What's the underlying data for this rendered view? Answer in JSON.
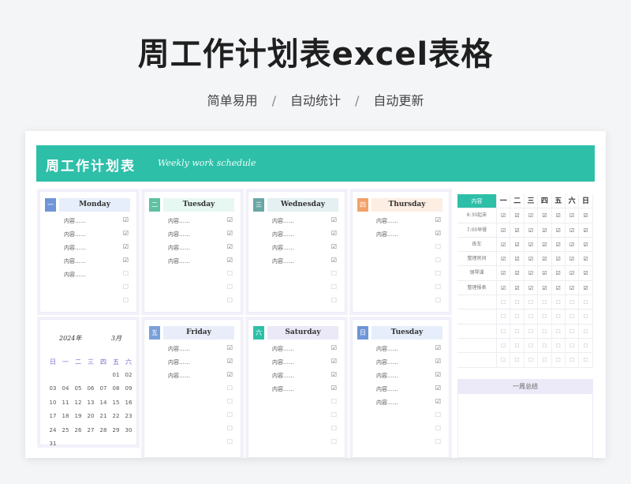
{
  "title": "周工作计划表excel表格",
  "tags": [
    "简单易用",
    "自动统计",
    "自动更新"
  ],
  "tag_separator": "/",
  "banner": {
    "cn": "周工作计划表",
    "en": "Weekly work schedule"
  },
  "days": [
    {
      "num": "一",
      "name": "Monday",
      "color": "#6f95d8",
      "headbg": "#e6eefb",
      "tasks": [
        {
          "text": "内容……",
          "done": "☑"
        },
        {
          "text": "内容……",
          "done": "☑"
        },
        {
          "text": "内容……",
          "done": "☑"
        },
        {
          "text": "内容……",
          "done": "☑"
        },
        {
          "text": "内容……",
          "done": "☐"
        },
        {
          "text": "",
          "done": "☐"
        },
        {
          "text": "",
          "done": "☐"
        }
      ]
    },
    {
      "num": "二",
      "name": "Tuesday",
      "color": "#5fc1a2",
      "headbg": "#e7f7f2",
      "tasks": [
        {
          "text": "内容……",
          "done": "☑"
        },
        {
          "text": "内容……",
          "done": "☑"
        },
        {
          "text": "内容……",
          "done": "☑"
        },
        {
          "text": "内容……",
          "done": "☑"
        },
        {
          "text": "",
          "done": "☐"
        },
        {
          "text": "",
          "done": "☐"
        },
        {
          "text": "",
          "done": "☐"
        }
      ]
    },
    {
      "num": "三",
      "name": "Wednesday",
      "color": "#6aa6a5",
      "headbg": "#e4f0f2",
      "tasks": [
        {
          "text": "内容……",
          "done": "☑"
        },
        {
          "text": "内容……",
          "done": "☑"
        },
        {
          "text": "内容……",
          "done": "☑"
        },
        {
          "text": "内容……",
          "done": "☑"
        },
        {
          "text": "",
          "done": "☐"
        },
        {
          "text": "",
          "done": "☐"
        },
        {
          "text": "",
          "done": "☐"
        }
      ]
    },
    {
      "num": "四",
      "name": "Thursday",
      "color": "#f2a168",
      "headbg": "#fdeee3",
      "tasks": [
        {
          "text": "内容……",
          "done": "☑"
        },
        {
          "text": "内容……",
          "done": "☑"
        },
        {
          "text": "",
          "done": "☐"
        },
        {
          "text": "",
          "done": "☐"
        },
        {
          "text": "",
          "done": "☐"
        },
        {
          "text": "",
          "done": "☐"
        },
        {
          "text": "",
          "done": "☐"
        }
      ]
    },
    {
      "num": "五",
      "name": "Friday",
      "color": "#7aa0da",
      "headbg": "#e9edf9",
      "tasks": [
        {
          "text": "内容……",
          "done": "☑"
        },
        {
          "text": "内容……",
          "done": "☑"
        },
        {
          "text": "内容……",
          "done": "☑"
        },
        {
          "text": "",
          "done": "☐"
        },
        {
          "text": "",
          "done": "☐"
        },
        {
          "text": "",
          "done": "☐"
        },
        {
          "text": "",
          "done": "☐"
        },
        {
          "text": "",
          "done": "☐"
        }
      ]
    },
    {
      "num": "六",
      "name": "Saturday",
      "color": "#2ebfa9",
      "headbg": "#ebe9f8",
      "tasks": [
        {
          "text": "内容……",
          "done": "☑"
        },
        {
          "text": "内容……",
          "done": "☑"
        },
        {
          "text": "内容……",
          "done": "☑"
        },
        {
          "text": "内容……",
          "done": "☑"
        },
        {
          "text": "",
          "done": "☐"
        },
        {
          "text": "",
          "done": "☐"
        },
        {
          "text": "",
          "done": "☐"
        },
        {
          "text": "",
          "done": "☐"
        }
      ]
    },
    {
      "num": "日",
      "name": "Tuesday",
      "color": "#6f95d8",
      "headbg": "#e6eefb",
      "tasks": [
        {
          "text": "内容……",
          "done": "☑"
        },
        {
          "text": "内容……",
          "done": "☑"
        },
        {
          "text": "内容……",
          "done": "☑"
        },
        {
          "text": "内容……",
          "done": "☑"
        },
        {
          "text": "内容……",
          "done": "☑"
        },
        {
          "text": "",
          "done": "☐"
        },
        {
          "text": "",
          "done": "☐"
        },
        {
          "text": "",
          "done": "☐"
        }
      ]
    }
  ],
  "calendar": {
    "year": "2024年",
    "month": "3月",
    "weekdays": [
      "日",
      "一",
      "二",
      "三",
      "四",
      "五",
      "六"
    ],
    "weeks": [
      [
        "",
        "",
        "",
        "",
        "",
        "01",
        "02"
      ],
      [
        "03",
        "04",
        "05",
        "06",
        "07",
        "08",
        "09"
      ],
      [
        "10",
        "11",
        "12",
        "13",
        "14",
        "15",
        "16"
      ],
      [
        "17",
        "18",
        "19",
        "20",
        "21",
        "22",
        "23"
      ],
      [
        "24",
        "25",
        "26",
        "27",
        "28",
        "29",
        "30"
      ],
      [
        "31",
        "",
        "",
        "",
        "",
        "",
        ""
      ]
    ]
  },
  "matrix": {
    "header_label": "内容",
    "days": [
      "一",
      "二",
      "三",
      "四",
      "五",
      "六",
      "日"
    ],
    "rows": [
      {
        "label": "6:30起床",
        "marks": [
          "☑",
          "☑",
          "☑",
          "☑",
          "☑",
          "☑",
          "☑"
        ]
      },
      {
        "label": "7:00早餐",
        "marks": [
          "☑",
          "☑",
          "☑",
          "☑",
          "☑",
          "☑",
          "☑"
        ]
      },
      {
        "label": "练车",
        "marks": [
          "☑",
          "☑",
          "☑",
          "☑",
          "☑",
          "☑",
          "☑"
        ]
      },
      {
        "label": "整理房间",
        "marks": [
          "☑",
          "☑",
          "☑",
          "☑",
          "☑",
          "☑",
          "☑"
        ]
      },
      {
        "label": "钢琴课",
        "marks": [
          "☑",
          "☑",
          "☑",
          "☑",
          "☑",
          "☑",
          "☑"
        ]
      },
      {
        "label": "整理报表",
        "marks": [
          "☑",
          "☑",
          "☑",
          "☑",
          "☑",
          "☑",
          "☑"
        ]
      },
      {
        "label": "",
        "marks": [
          "☐",
          "☐",
          "☐",
          "☐",
          "☐",
          "☐",
          "☐"
        ]
      },
      {
        "label": "",
        "marks": [
          "☐",
          "☐",
          "☐",
          "☐",
          "☐",
          "☐",
          "☐"
        ]
      },
      {
        "label": "",
        "marks": [
          "☐",
          "☐",
          "☐",
          "☐",
          "☐",
          "☐",
          "☐"
        ]
      },
      {
        "label": "",
        "marks": [
          "☐",
          "☐",
          "☐",
          "☐",
          "☐",
          "☐",
          "☐"
        ]
      },
      {
        "label": "",
        "marks": [
          "☐",
          "☐",
          "☐",
          "☐",
          "☐",
          "☐",
          "☐"
        ]
      }
    ]
  },
  "summary_title": "一周总结"
}
